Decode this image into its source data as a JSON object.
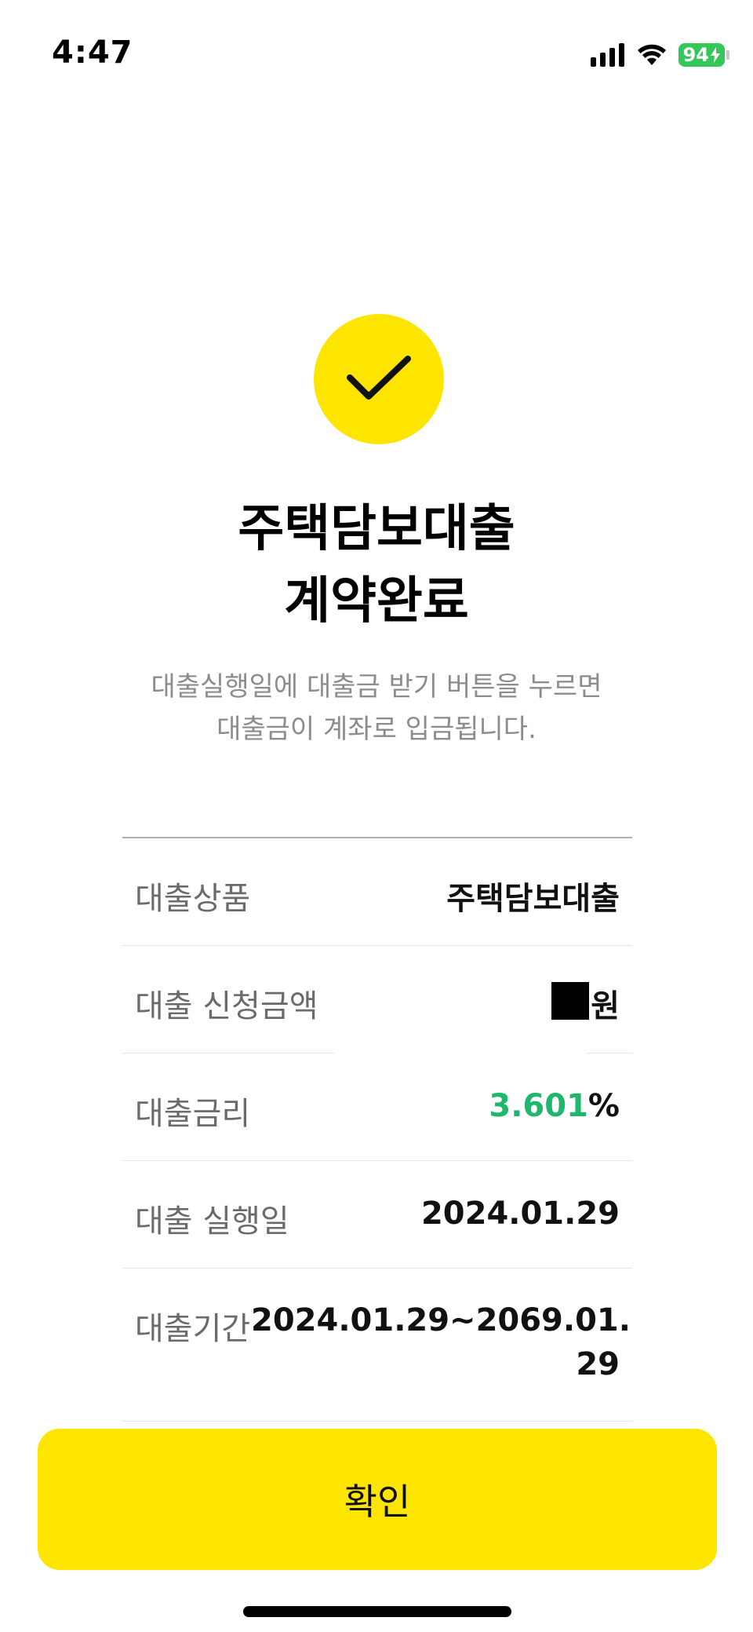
{
  "status_bar": {
    "time": "4:47",
    "battery_level": "94"
  },
  "colors": {
    "accent_yellow": "#fee500",
    "rate_green": "#1fb66e",
    "battery_green": "#34c759"
  },
  "icons": {
    "check": "check-icon",
    "signal": "signal-icon",
    "wifi": "wifi-icon",
    "battery": "battery-icon"
  },
  "header": {
    "title_line1": "주택담보대출",
    "title_line2": "계약완료",
    "subtitle_line1": "대출실행일에 대출금 받기 버튼을 누르면",
    "subtitle_line2": "대출금이 계좌로 입금됩니다."
  },
  "details": {
    "product": {
      "label": "대출상품",
      "value": "주택담보대출"
    },
    "amount": {
      "label": "대출 신청금액",
      "value_suffix": "원"
    },
    "rate": {
      "label": "대출금리",
      "value_number": "3.601",
      "value_unit": "%"
    },
    "execution_date": {
      "label": "대출 실행일",
      "value": "2024.01.29"
    },
    "period": {
      "label": "대출기간",
      "value_line1": "2024.01.29~2069.01.",
      "value_line2": "29"
    }
  },
  "confirm_button": {
    "label": "확인"
  }
}
